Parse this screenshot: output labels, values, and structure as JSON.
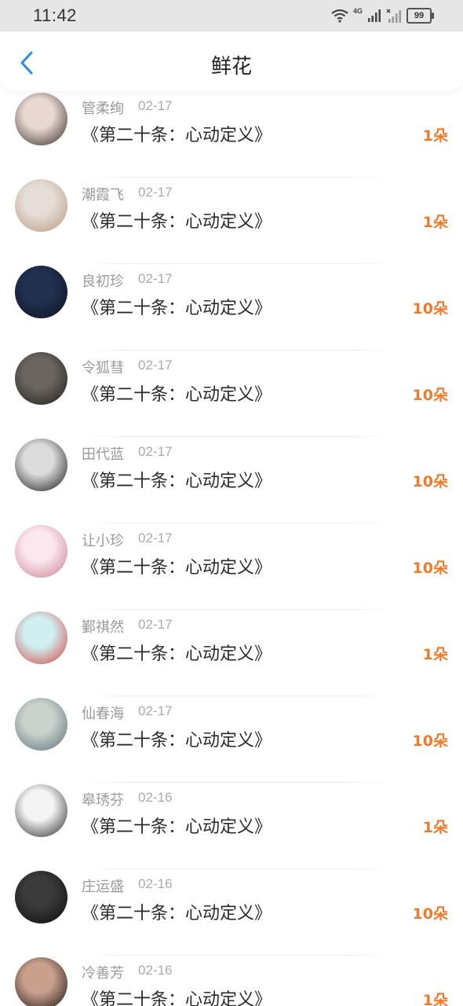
{
  "status_bar": {
    "time": "11:42",
    "network_label": "4G",
    "battery": "99"
  },
  "header": {
    "title": "鲜花",
    "back_icon": "chevron-left-icon",
    "accent_color": "#2a8be8"
  },
  "colors": {
    "count": "#f07a2a",
    "name": "#9a9a9a",
    "text": "#2a2a2a"
  },
  "records": [
    {
      "name": "管柔绚",
      "date": "02-17",
      "book": "《第二十条：心动定义》",
      "count": "1朵",
      "avatar_colors": [
        "#e9d8d2",
        "#2e2622"
      ]
    },
    {
      "name": "潮霞飞",
      "date": "02-17",
      "book": "《第二十条：心动定义》",
      "count": "1朵",
      "avatar_colors": [
        "#e5ddd6",
        "#b89880"
      ]
    },
    {
      "name": "良初珍",
      "date": "02-17",
      "book": "《第二十条：心动定义》",
      "count": "10朵",
      "avatar_colors": [
        "#20304e",
        "#0d1322"
      ]
    },
    {
      "name": "令狐彗",
      "date": "02-17",
      "book": "《第二十条：心动定义》",
      "count": "10朵",
      "avatar_colors": [
        "#6b655f",
        "#1f1c19"
      ]
    },
    {
      "name": "田代蓝",
      "date": "02-17",
      "book": "《第二十条：心动定义》",
      "count": "10朵",
      "avatar_colors": [
        "#dcdcdc",
        "#111111"
      ]
    },
    {
      "name": "让小珍",
      "date": "02-17",
      "book": "《第二十条：心动定义》",
      "count": "10朵",
      "avatar_colors": [
        "#fbe8ee",
        "#c77c8f"
      ]
    },
    {
      "name": "鄞祺然",
      "date": "02-17",
      "book": "《第二十条：心动定义》",
      "count": "1朵",
      "avatar_colors": [
        "#cfeff0",
        "#d93b3b"
      ]
    },
    {
      "name": "仙春海",
      "date": "02-17",
      "book": "《第二十条：心动定义》",
      "count": "10朵",
      "avatar_colors": [
        "#cbd2cc",
        "#5a6e7c"
      ]
    },
    {
      "name": "皋琇芬",
      "date": "02-16",
      "book": "《第二十条：心动定义》",
      "count": "1朵",
      "avatar_colors": [
        "#f4f4f4",
        "#222222"
      ]
    },
    {
      "name": "庄运盛",
      "date": "02-16",
      "book": "《第二十条：心动定义》",
      "count": "10朵",
      "avatar_colors": [
        "#3a3a3a",
        "#0b0b0b"
      ]
    },
    {
      "name": "冷善芳",
      "date": "02-16",
      "book": "《第二十条：心动定义》",
      "count": "1朵",
      "avatar_colors": [
        "#c9a08c",
        "#120c0c"
      ]
    }
  ]
}
